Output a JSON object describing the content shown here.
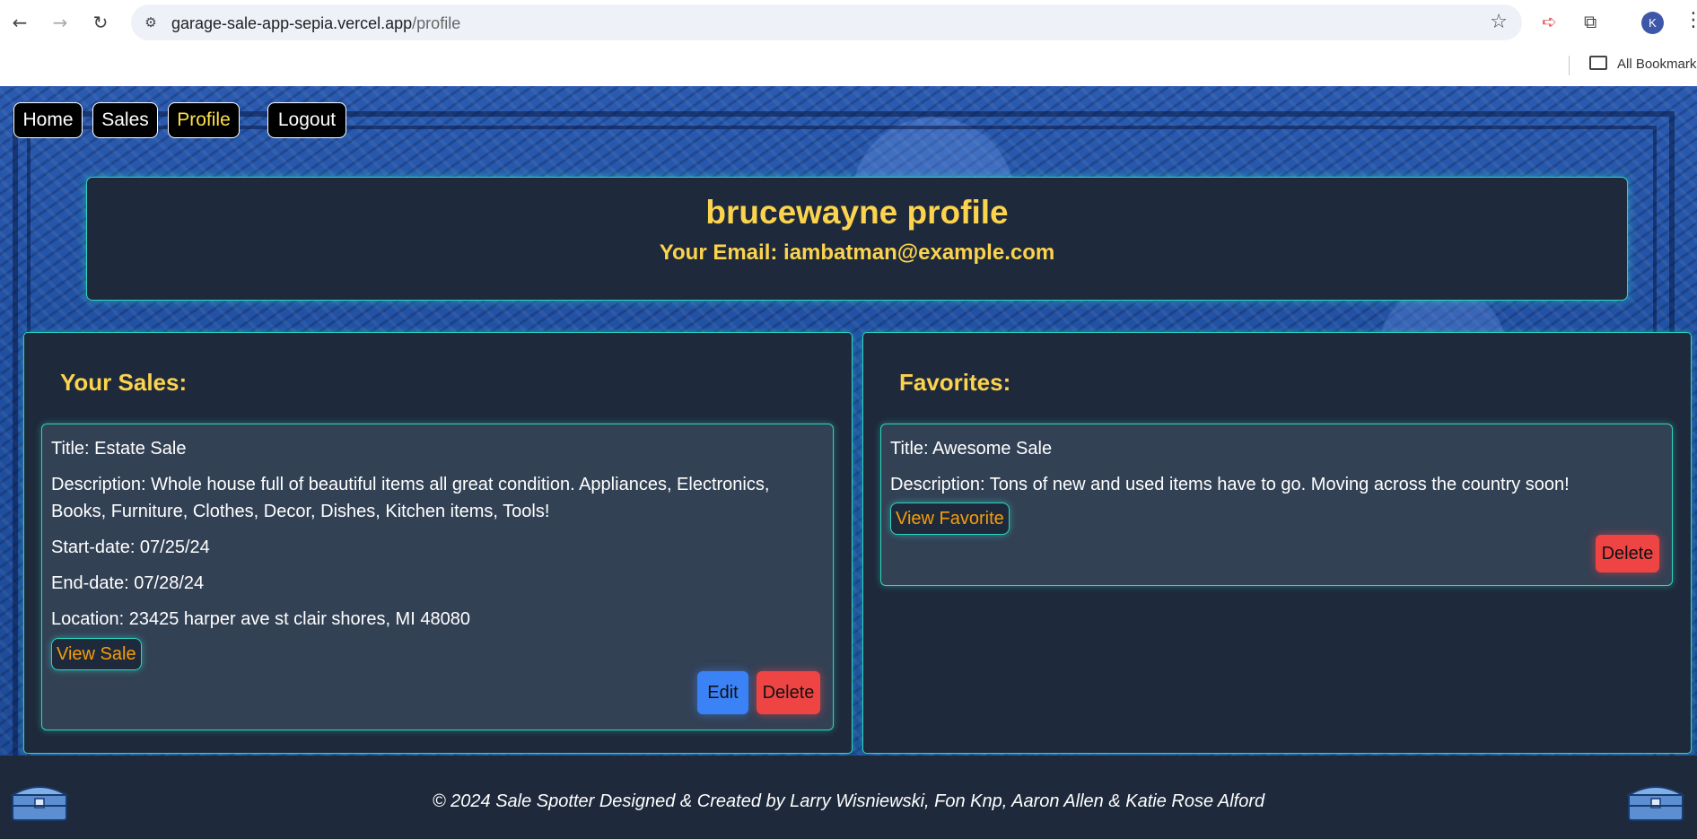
{
  "browser": {
    "url_host": "garage-sale-app-sepia.vercel.app",
    "url_path": "/profile",
    "profile_initial": "K",
    "bookmarks_label": "All Bookmarks"
  },
  "nav": {
    "home": "Home",
    "sales": "Sales",
    "profile": "Profile",
    "logout": "Logout",
    "active": "Profile"
  },
  "profile": {
    "title": "brucewayne profile",
    "email_line": "Your Email: iambatman@example.com"
  },
  "your_sales": {
    "heading": "Your Sales:",
    "items": [
      {
        "title": "Title: Estate Sale",
        "description_line1": "Description: Whole house full of beautiful items all great condition. Appliances, Electronics,",
        "description_line2": "Books, Furniture, Clothes, Decor, Dishes, Kitchen items, Tools!",
        "start": "Start-date: 07/25/24",
        "end": "End-date: 07/28/24",
        "location": "Location: 23425 harper ave st clair shores, MI 48080",
        "view_label": "View Sale",
        "edit_label": "Edit",
        "delete_label": "Delete"
      }
    ]
  },
  "favorites": {
    "heading": "Favorites:",
    "items": [
      {
        "title": "Title: Awesome Sale",
        "description": "Description: Tons of new and used items have to go. Moving across the country soon!",
        "view_label": "View Favorite",
        "delete_label": "Delete"
      }
    ]
  },
  "footer": {
    "text": "© 2024 Sale Spotter Designed & Created by Larry Wisniewski, Fon Knp, Aaron Allen & Katie Rose Alford"
  },
  "colors": {
    "accent_yellow": "#fcd34d",
    "teal_border": "#2dd4bf",
    "panel_bg": "#1e293b",
    "card_bg": "#334155",
    "edit_blue": "#3b82f6",
    "delete_red": "#ef4444"
  }
}
